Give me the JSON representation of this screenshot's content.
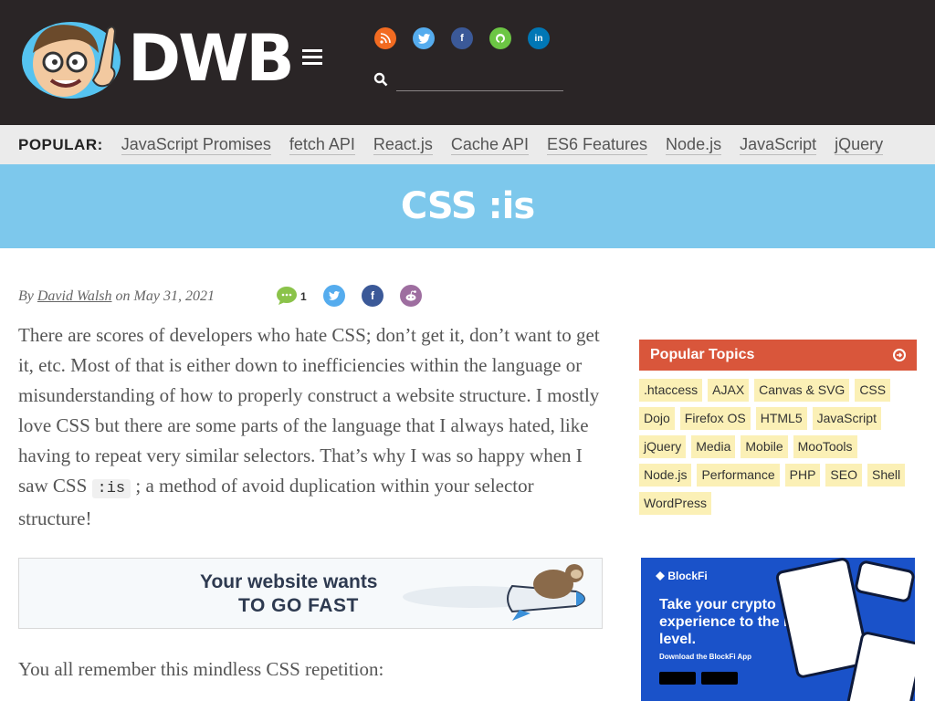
{
  "header": {
    "logo_text": "DWB",
    "search": {
      "value": "",
      "placeholder": ""
    },
    "social_icons": [
      {
        "name": "rss-icon",
        "color": "#f26b21"
      },
      {
        "name": "twitter-icon",
        "color": "#55acee"
      },
      {
        "name": "facebook-icon",
        "color": "#3b5998"
      },
      {
        "name": "github-icon",
        "color": "#6cc644"
      },
      {
        "name": "linkedin-icon",
        "color": "#0077b5"
      }
    ]
  },
  "popular": {
    "label": "POPULAR:",
    "links": [
      "JavaScript Promises",
      "fetch API",
      "React.js",
      "Cache API",
      "ES6 Features",
      "Node.js",
      "JavaScript",
      "jQuery"
    ]
  },
  "title": "CSS :is",
  "byline": {
    "by": "By",
    "author": "David Walsh",
    "on": "on May 31, 2021",
    "comment_count": "1"
  },
  "article": {
    "p1_before_code": "There are scores of developers who hate CSS; don’t get it, don’t want to get it, etc. Most of that is either down to inefficiencies within the language or misunderstanding of how to properly construct a website structure. I mostly love CSS but there are some parts of the language that I always hated, like having to repeat very similar selectors. That’s why I was so happy when I saw CSS",
    "p1_code": ":is",
    "p1_after_code": "; a method of avoid duplication within your selector structure!",
    "p2": "You all remember this mindless CSS repetition:"
  },
  "ad_banner": {
    "line1": "Your website wants",
    "line2": "TO GO FAST"
  },
  "sidebar": {
    "topics_title": "Popular Topics",
    "tags": [
      ".htaccess",
      "AJAX",
      "Canvas & SVG",
      "CSS",
      "Dojo",
      "Firefox OS",
      "HTML5",
      "JavaScript",
      "jQuery",
      "Media",
      "Mobile",
      "MooTools",
      "Node.js",
      "Performance",
      "PHP",
      "SEO",
      "Shell",
      "WordPress"
    ],
    "accent_color": "#d9563b",
    "tag_color": "#fbf0b6"
  },
  "blockfi_ad": {
    "brand": "BlockFi",
    "headline": "Take your crypto experience to the next level.",
    "subline": "Download the BlockFi App"
  }
}
